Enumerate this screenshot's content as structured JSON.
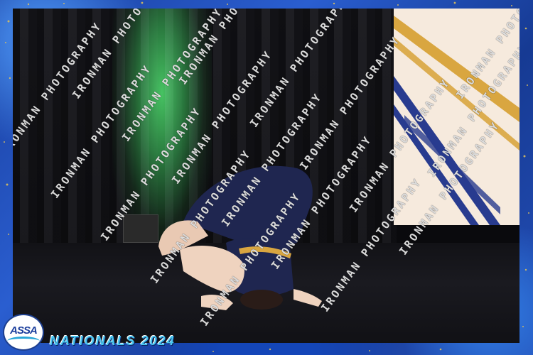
{
  "watermark": {
    "text": "IRONMAN PHOTOGRAPHY",
    "rows": [
      {
        "lines": 10
      },
      {
        "lines": 10
      }
    ]
  },
  "logo": {
    "text": "ASSA"
  },
  "caption": {
    "text": "NATIONALS 2024"
  },
  "colors": {
    "frame_blue": "#1d3f8f",
    "caption_cyan": "#49c7f0",
    "stage_light_green": "#3fc95c",
    "banner_cream": "#f6eadd",
    "banner_stripe_gold": "#d9a640",
    "banner_stripe_navy": "#283b8f",
    "leotard_navy": "#1f2650"
  }
}
